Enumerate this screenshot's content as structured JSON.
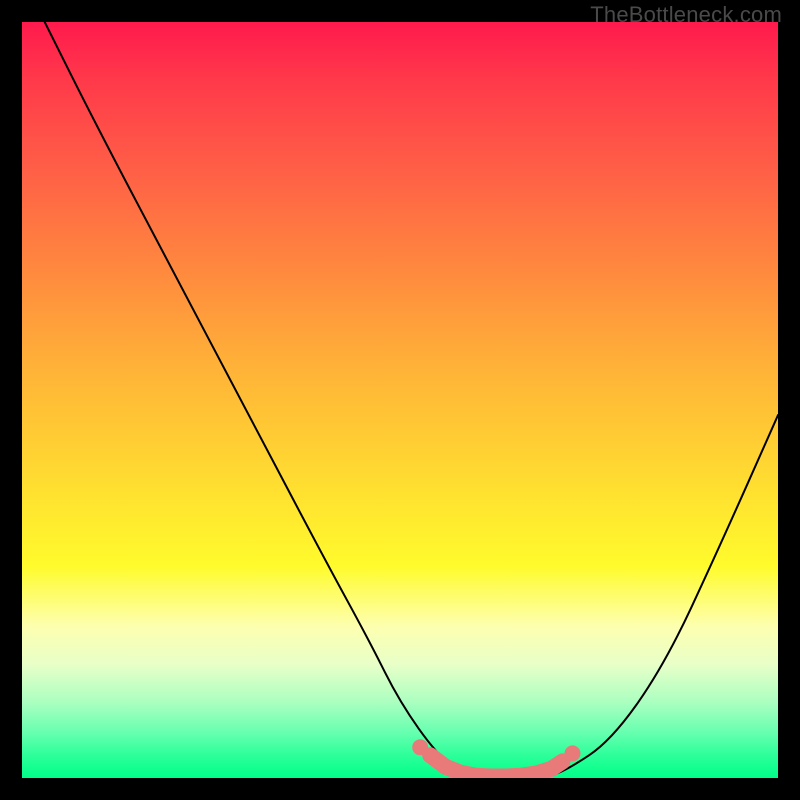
{
  "watermark": "TheBottleneck.com",
  "gradient_colors": {
    "top": "#ff1a4d",
    "mid_orange": "#ff8040",
    "yellow": "#ffe030",
    "pale": "#fdffb0",
    "green": "#00ff88"
  },
  "marker_color": "#e97a7a",
  "curve_color": "#000000",
  "chart_data": {
    "type": "line",
    "title": "",
    "xlabel": "",
    "ylabel": "",
    "xlim": [
      0,
      100
    ],
    "ylim": [
      0,
      100
    ],
    "grid": false,
    "series": [
      {
        "name": "bottleneck-curve",
        "x": [
          3,
          10,
          20,
          30,
          40,
          46,
          50,
          55,
          58,
          60,
          63,
          66,
          69,
          72,
          78,
          85,
          92,
          100
        ],
        "y": [
          100,
          86,
          67,
          48,
          29,
          18,
          10,
          3,
          1,
          0,
          0,
          0,
          0,
          1,
          5,
          15,
          30,
          48
        ]
      }
    ],
    "markers": {
      "name": "highlight-segment",
      "x": [
        54,
        56,
        58,
        60,
        62,
        64,
        66,
        68,
        70,
        71.5
      ],
      "y": [
        3,
        1.5,
        0.7,
        0.3,
        0.2,
        0.2,
        0.3,
        0.6,
        1.2,
        2.2
      ]
    },
    "legend": false
  }
}
